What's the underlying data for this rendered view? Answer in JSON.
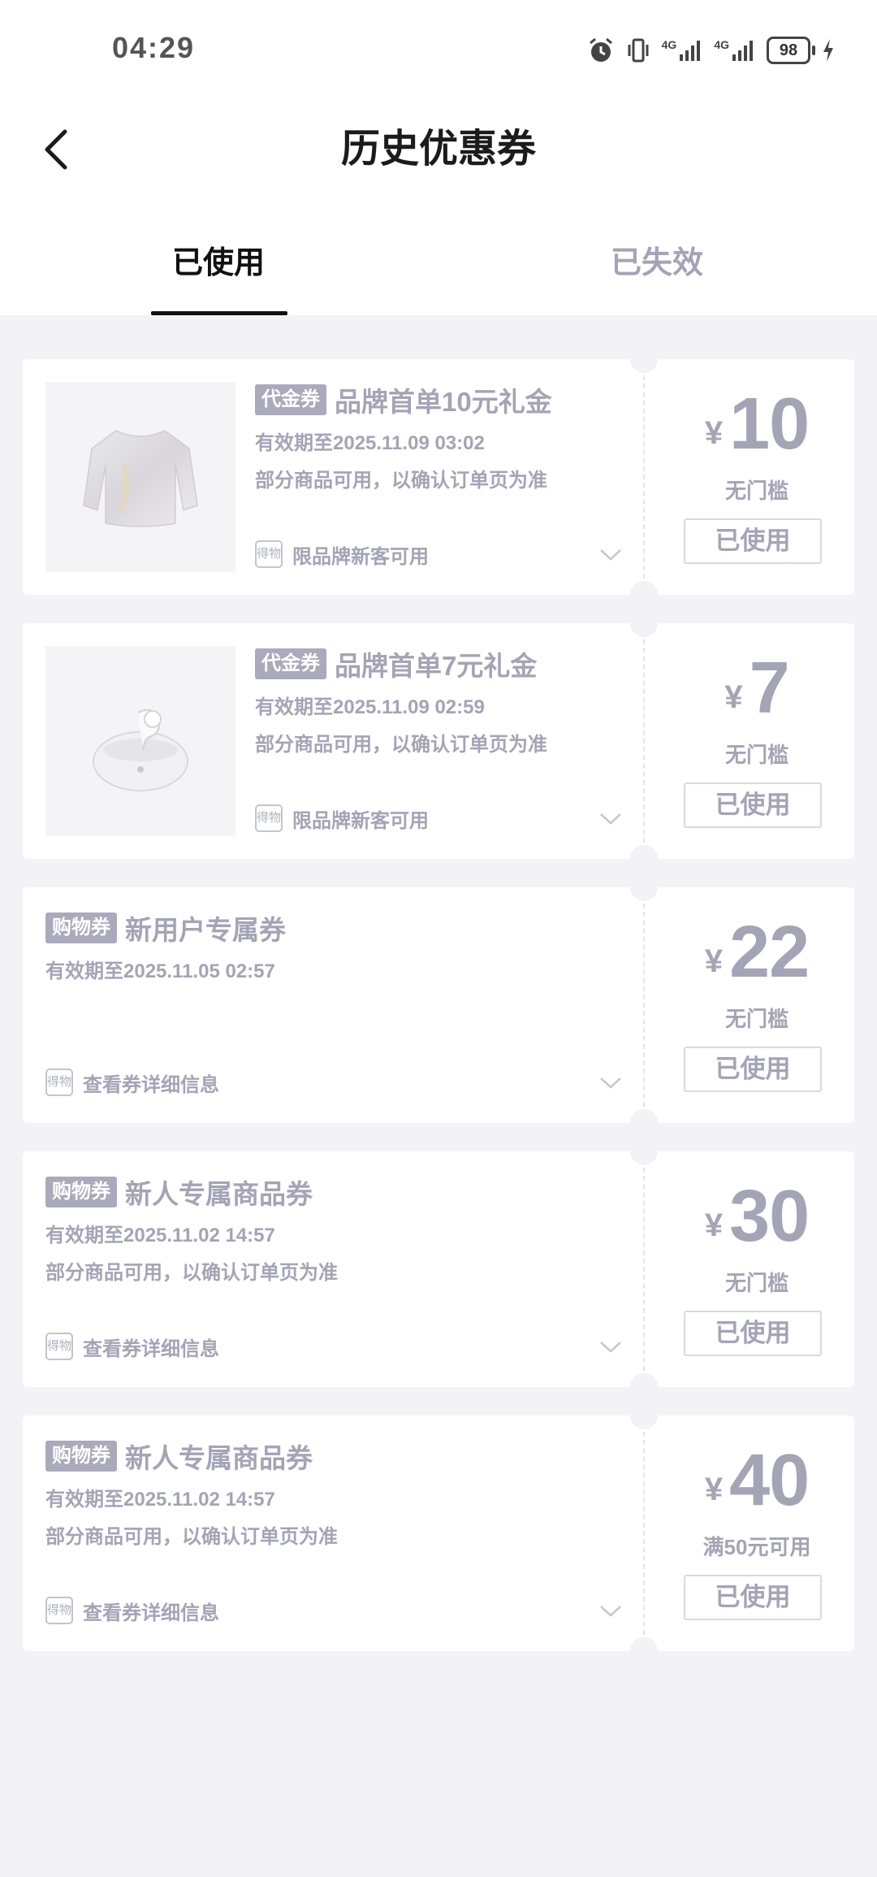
{
  "status_bar": {
    "time": "04:29",
    "network_1": "4G",
    "network_2": "4G",
    "battery": "98"
  },
  "header": {
    "title": "历史优惠券"
  },
  "tabs": [
    {
      "label": "已使用",
      "active": true
    },
    {
      "label": "已失效",
      "active": false
    }
  ],
  "coupons": [
    {
      "tag": "代金券",
      "title": "品牌首单10元礼金",
      "validity": "有效期至2025.11.09 03:02",
      "scope": "部分商品可用，以确认订单页为准",
      "bottom_text": "限品牌新客可用",
      "shop_icon_text": "得物",
      "currency": "¥",
      "amount": "10",
      "threshold": "无门槛",
      "status": "已使用",
      "has_image": true,
      "image_icon": "sweater-icon"
    },
    {
      "tag": "代金券",
      "title": "品牌首单7元礼金",
      "validity": "有效期至2025.11.09 02:59",
      "scope": "部分商品可用，以确认订单页为准",
      "bottom_text": "限品牌新客可用",
      "shop_icon_text": "得物",
      "currency": "¥",
      "amount": "7",
      "threshold": "无门槛",
      "status": "已使用",
      "has_image": true,
      "image_icon": "earbuds-icon"
    },
    {
      "tag": "购物券",
      "title": "新用户专属券",
      "validity": "有效期至2025.11.05 02:57",
      "scope": "",
      "bottom_text": "查看券详细信息",
      "shop_icon_text": "得物",
      "currency": "¥",
      "amount": "22",
      "threshold": "无门槛",
      "status": "已使用",
      "has_image": false
    },
    {
      "tag": "购物券",
      "title": "新人专属商品券",
      "validity": "有效期至2025.11.02 14:57",
      "scope": "部分商品可用，以确认订单页为准",
      "bottom_text": "查看券详细信息",
      "shop_icon_text": "得物",
      "currency": "¥",
      "amount": "30",
      "threshold": "无门槛",
      "status": "已使用",
      "has_image": false
    },
    {
      "tag": "购物券",
      "title": "新人专属商品券",
      "validity": "有效期至2025.11.02 14:57",
      "scope": "部分商品可用，以确认订单页为准",
      "bottom_text": "查看券详细信息",
      "shop_icon_text": "得物",
      "currency": "¥",
      "amount": "40",
      "threshold": "满50元可用",
      "status": "已使用",
      "has_image": false
    }
  ],
  "colors": {
    "page_bg": "#f3f3f7",
    "muted_text": "#a3a4b5",
    "tag_bg": "#a9aabb",
    "active_tab": "#111111"
  }
}
